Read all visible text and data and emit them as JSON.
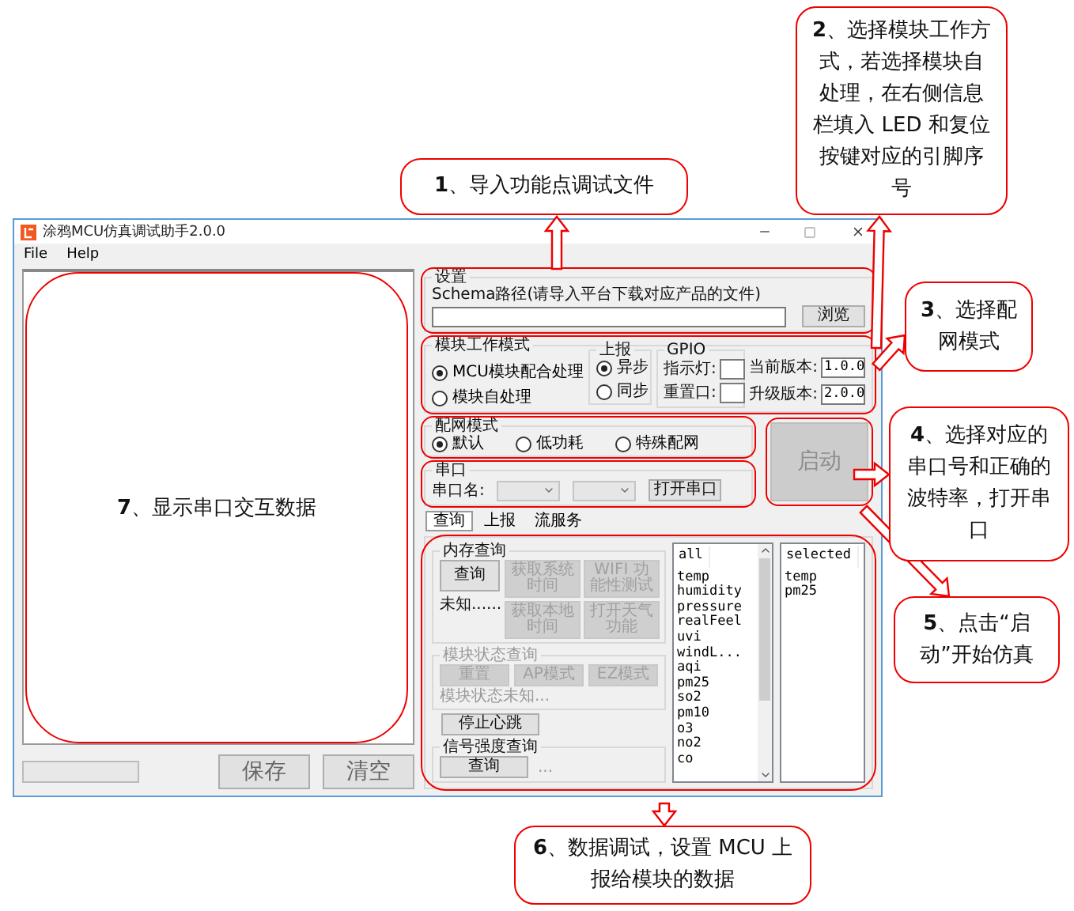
{
  "window": {
    "title": "涂鸦MCU仿真调试助手2.0.0"
  },
  "menu": [
    "File",
    "Help"
  ],
  "log": {
    "annotation": "**7**、显示串口交互数据"
  },
  "bottom_buttons": [
    "保存",
    "清空"
  ],
  "settings": {
    "title": "设置",
    "schema_label": "Schema路径(请导入平台下载对应产品的文件)",
    "browse_button": "浏览"
  },
  "work_mode": {
    "title": "模块工作模式",
    "options": [
      {
        "label": "MCU模块配合处理",
        "selected": true
      },
      {
        "label": "模块自处理",
        "selected": false
      }
    ],
    "report": {
      "title": "上报",
      "options": [
        {
          "label": "异步",
          "selected": true
        },
        {
          "label": "同步",
          "selected": false
        }
      ]
    },
    "gpio": {
      "title": "GPIO",
      "fields": [
        "指示灯:",
        "重置口:"
      ]
    },
    "versions": [
      {
        "label": "当前版本:",
        "value": "1.0.0"
      },
      {
        "label": "升级版本:",
        "value": "2.0.0"
      }
    ]
  },
  "network_mode": {
    "title": "配网模式",
    "options": [
      {
        "label": "默认",
        "selected": true
      },
      {
        "label": "低功耗",
        "selected": false
      },
      {
        "label": "特殊配网",
        "selected": false
      }
    ]
  },
  "serial": {
    "title": "串口",
    "label": "串口名:",
    "open_button": "打开串口"
  },
  "start_button": {
    "label": "启动",
    "disabled": true
  },
  "tabs": [
    {
      "label": "查询",
      "selected": true
    },
    {
      "label": "上报",
      "selected": false
    },
    {
      "label": "流服务",
      "selected": false
    }
  ],
  "memory_query": {
    "title": "内存查询",
    "button": "查询",
    "status": "未知......"
  },
  "actions": [
    {
      "label": "获取系统时间",
      "disabled": true
    },
    {
      "label": "WIFI 功能性测试",
      "disabled": true
    },
    {
      "label": "获取本地时间",
      "disabled": true
    },
    {
      "label": "打开天气功能",
      "disabled": true
    }
  ],
  "module_status": {
    "title": "模块状态查询",
    "disabled": true,
    "buttons": [
      "重置",
      "AP模式",
      "EZ模式"
    ],
    "status": "模块状态未知..."
  },
  "heartbeat_button": "停止心跳",
  "signal": {
    "title": "信号强度查询",
    "button": "查询",
    "value": "..."
  },
  "dp_lists": [
    {
      "header": "all",
      "scrollbar": true,
      "items": [
        "temp",
        "humidity",
        "pressure",
        "realFeel",
        "uvi",
        "windL...",
        "aqi",
        "pm25",
        "so2",
        "pm10",
        "o3",
        "no2",
        "co"
      ]
    },
    {
      "header": "selected",
      "scrollbar": false,
      "items": [
        "temp",
        "pm25"
      ]
    }
  ],
  "callouts": [
    "**1**、导入功能点调试文件",
    "**2**、选择模块工作方式，若选择模块自处理，在右侧信息栏填入 LED 和复位按键对应的引脚序号",
    "**3**、选择配网模式",
    "**4**、选择对应的串口号和正确的波特率，打开串口",
    "**5**、点击“启动”开始仿真",
    "**6**、数据调试，设置 MCU 上报给模块的数据"
  ]
}
